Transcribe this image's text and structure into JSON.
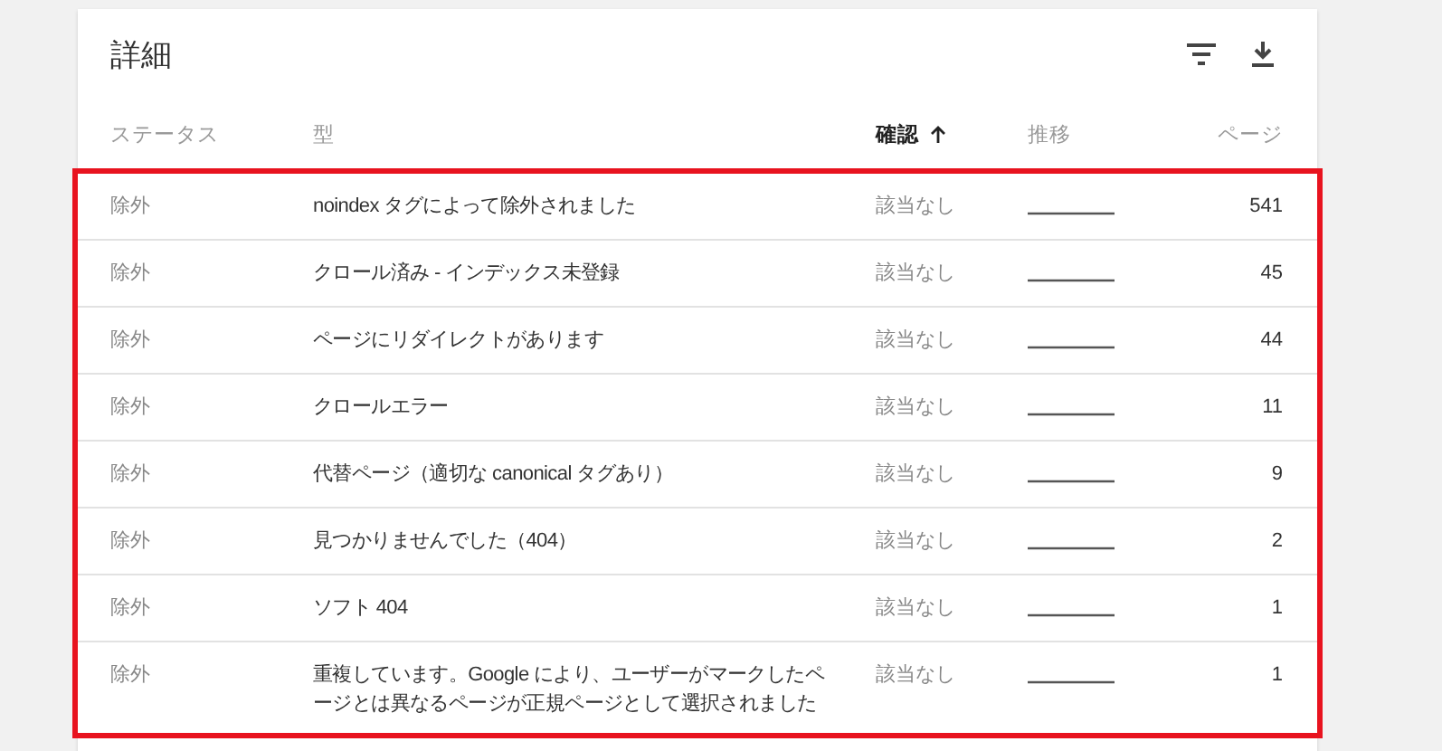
{
  "card": {
    "title": "詳細"
  },
  "table": {
    "columns": [
      {
        "label": "ステータス",
        "kind": "text",
        "sorted": false
      },
      {
        "label": "型",
        "kind": "text",
        "sorted": false
      },
      {
        "label": "確認",
        "kind": "text",
        "sorted": true,
        "sort_ascending": true
      },
      {
        "label": "推移",
        "kind": "trend",
        "sorted": false
      },
      {
        "label": "ページ",
        "kind": "number",
        "sorted": false
      }
    ],
    "highlight_frame": true,
    "rows": [
      {
        "status": "除外",
        "type": "noindex タグによって除外されました",
        "check": "該当なし",
        "pages": "541"
      },
      {
        "status": "除外",
        "type": "クロール済み - インデックス未登録",
        "check": "該当なし",
        "pages": "45"
      },
      {
        "status": "除外",
        "type": "ページにリダイレクトがあります",
        "check": "該当なし",
        "pages": "44"
      },
      {
        "status": "除外",
        "type": "クロールエラー",
        "check": "該当なし",
        "pages": "11"
      },
      {
        "status": "除外",
        "type": "代替ページ（適切な canonical タグあり）",
        "check": "該当なし",
        "pages": "9"
      },
      {
        "status": "除外",
        "type": "見つかりませんでした（404）",
        "check": "該当なし",
        "pages": "2"
      },
      {
        "status": "除外",
        "type": "ソフト 404",
        "check": "該当なし",
        "pages": "1"
      },
      {
        "status": "除外",
        "type": "重複しています。Google により、ユーザーがマークしたページとは異なるページが正規ページとして選択されました",
        "check": "該当なし",
        "pages": "1"
      }
    ]
  }
}
